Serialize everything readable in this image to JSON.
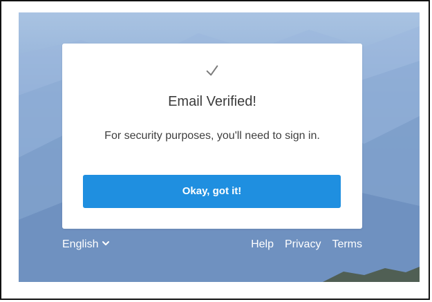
{
  "card": {
    "check_icon": "checkmark-icon",
    "title": "Email Verified!",
    "message": "For security purposes, you'll need to sign in.",
    "button_label": "Okay, got it!"
  },
  "footer": {
    "language": "English",
    "language_icon": "chevron-down-icon",
    "links": [
      "Help",
      "Privacy",
      "Terms"
    ]
  },
  "colors": {
    "button": "#1f8fe0",
    "background_sky": "#a9c3e2"
  }
}
